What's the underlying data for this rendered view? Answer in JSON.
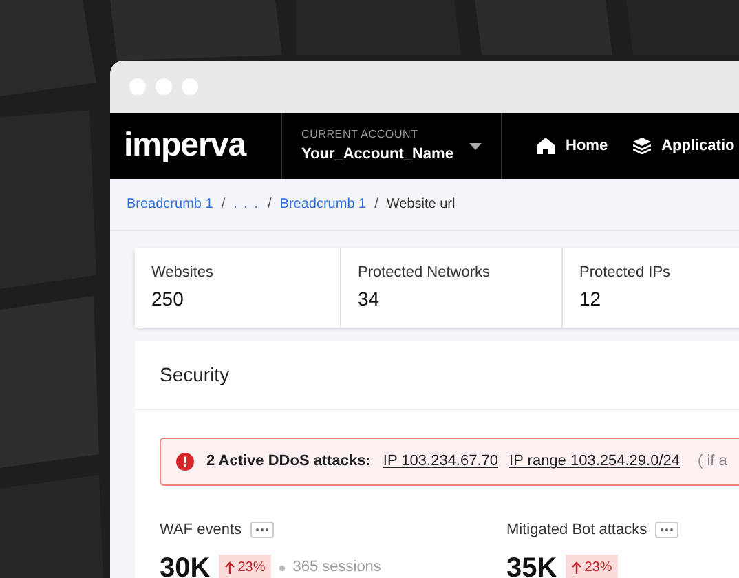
{
  "nav": {
    "logo": "imperva",
    "account_label": "CURRENT ACCOUNT",
    "account_name": "Your_Account_Name",
    "items": [
      {
        "label": "Home",
        "kind": "home"
      },
      {
        "label": "Applicatio",
        "kind": "layers"
      }
    ]
  },
  "breadcrumb": [
    {
      "label": "Breadcrumb 1",
      "kind": "link"
    },
    {
      "label": "/",
      "kind": "separator"
    },
    {
      "label": ". . .",
      "kind": "ellipsis"
    },
    {
      "label": "/",
      "kind": "separator"
    },
    {
      "label": "Breadcrumb 1",
      "kind": "link"
    },
    {
      "label": "/",
      "kind": "separator"
    },
    {
      "label": "Website url",
      "kind": "current"
    }
  ],
  "stats": [
    {
      "label": "Websites",
      "value": "250"
    },
    {
      "label": "Protected Networks",
      "value": "34"
    },
    {
      "label": "Protected IPs",
      "value": "12"
    }
  ],
  "security": {
    "title": "Security",
    "alert": {
      "text": "2 Active DDoS attacks:",
      "links": [
        "IP 103.234.67.70",
        "IP range 103.254.29.0/24"
      ],
      "more": "( if a"
    },
    "metrics": [
      {
        "label": "WAF events",
        "value": "30K",
        "change": "23%",
        "note": "365 sessions"
      },
      {
        "label": "Mitigated Bot attacks",
        "value": "35K",
        "change": "23%"
      }
    ]
  }
}
